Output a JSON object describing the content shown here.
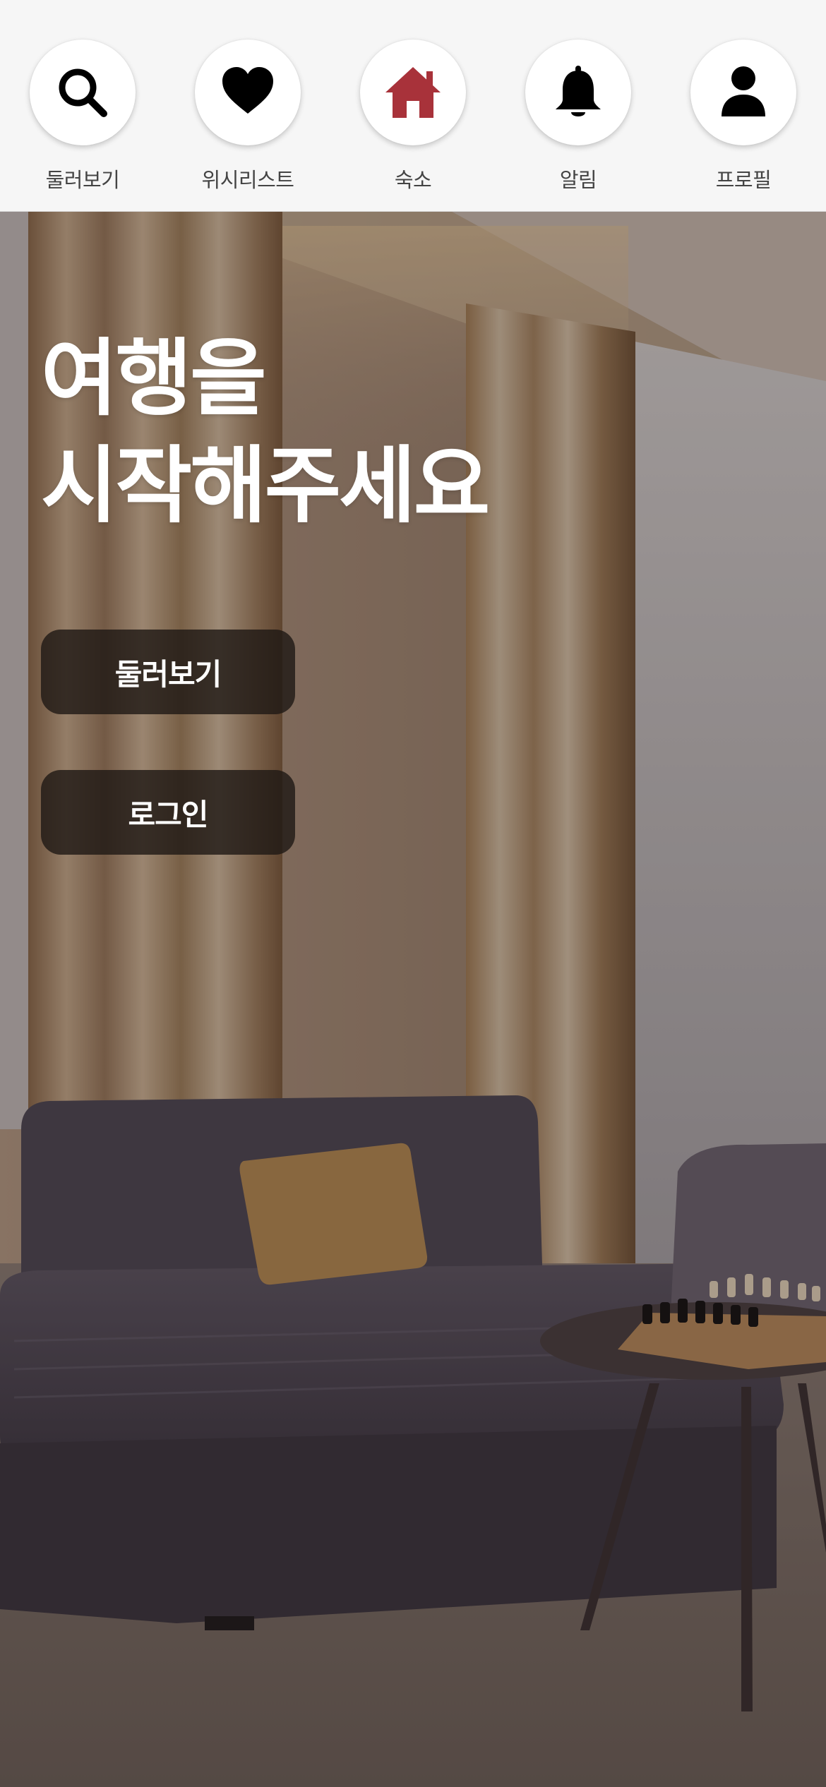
{
  "nav": {
    "items": [
      {
        "label": "둘러보기",
        "icon": "search-icon",
        "active": false
      },
      {
        "label": "위시리스트",
        "icon": "heart-icon",
        "active": false
      },
      {
        "label": "숙소",
        "icon": "home-icon",
        "active": true
      },
      {
        "label": "알림",
        "icon": "bell-icon",
        "active": false
      },
      {
        "label": "프로필",
        "icon": "user-icon",
        "active": false
      }
    ],
    "active_color": "#a8323a",
    "icon_color": "#000000"
  },
  "hero": {
    "title_line1": "여행을",
    "title_line2": "시작해주세요",
    "background": "living-room-photo",
    "buttons": {
      "browse_label": "둘러보기",
      "login_label": "로그인"
    }
  }
}
